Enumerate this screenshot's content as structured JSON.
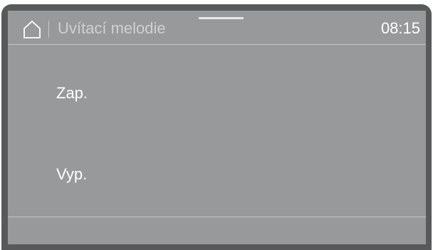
{
  "header": {
    "title": "Uvítací melodie",
    "time": "08:15"
  },
  "options": [
    {
      "label": "Zap."
    },
    {
      "label": "Vyp."
    }
  ]
}
